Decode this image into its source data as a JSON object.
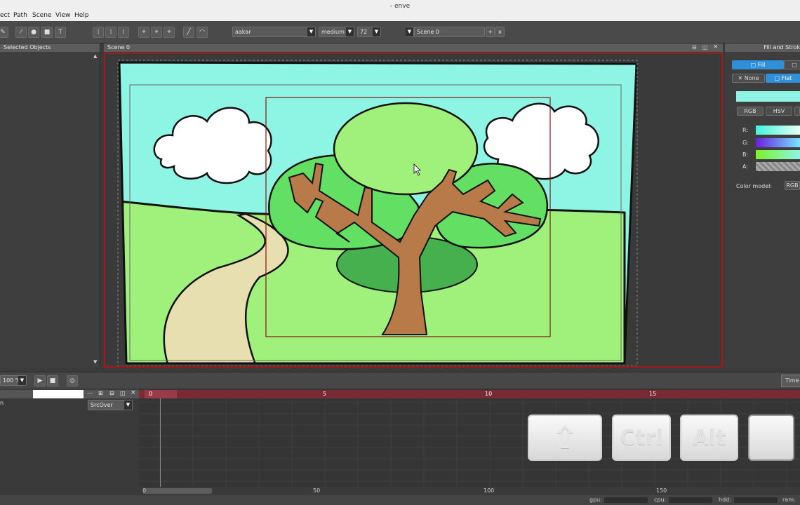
{
  "window": {
    "title": "- enve"
  },
  "menu": [
    "ect",
    "Path",
    "Scene",
    "View",
    "Help"
  ],
  "toolbar": {
    "font_family": "aakar",
    "font_weight": "medium",
    "font_size": "72",
    "scene_name": "Scene 0",
    "add_label": "+",
    "close_label": "x"
  },
  "panels": {
    "left_title": "Selected Objects",
    "scene_title": "Scene 0",
    "right_title": "Fill and Strok"
  },
  "fill_panel": {
    "fill_tab": "Fill",
    "none_label": "None",
    "flat_label": "Flat",
    "rgb_tab": "RGB",
    "hsv_tab": "HSV",
    "r_label": "R:",
    "g_label": "G:",
    "b_label": "B:",
    "a_label": "A:",
    "color_model_label": "Color model:",
    "color_model_value": "RGB",
    "current_color": "#8ef5e4"
  },
  "playback": {
    "zoom": "100 %",
    "time_tab": "Time"
  },
  "layers": {
    "blend_mode": "SrcOver"
  },
  "timeline": {
    "top_ticks": [
      "0",
      "5",
      "10",
      "15"
    ],
    "bottom_ticks": [
      "0",
      "50",
      "100",
      "150"
    ]
  },
  "keys": {
    "shift": "⇧",
    "ctrl": "Ctrl",
    "alt": "Alt",
    "blank": ""
  },
  "status": {
    "gpu": "gpu:",
    "cpu": "cpu:",
    "hdd": "hdd:",
    "ram": "ram:"
  },
  "colors": {
    "sky": "#8ef5e4",
    "grass": "#a0f07c",
    "frame": "#a01a1a",
    "accent": "#2f8fd8"
  }
}
